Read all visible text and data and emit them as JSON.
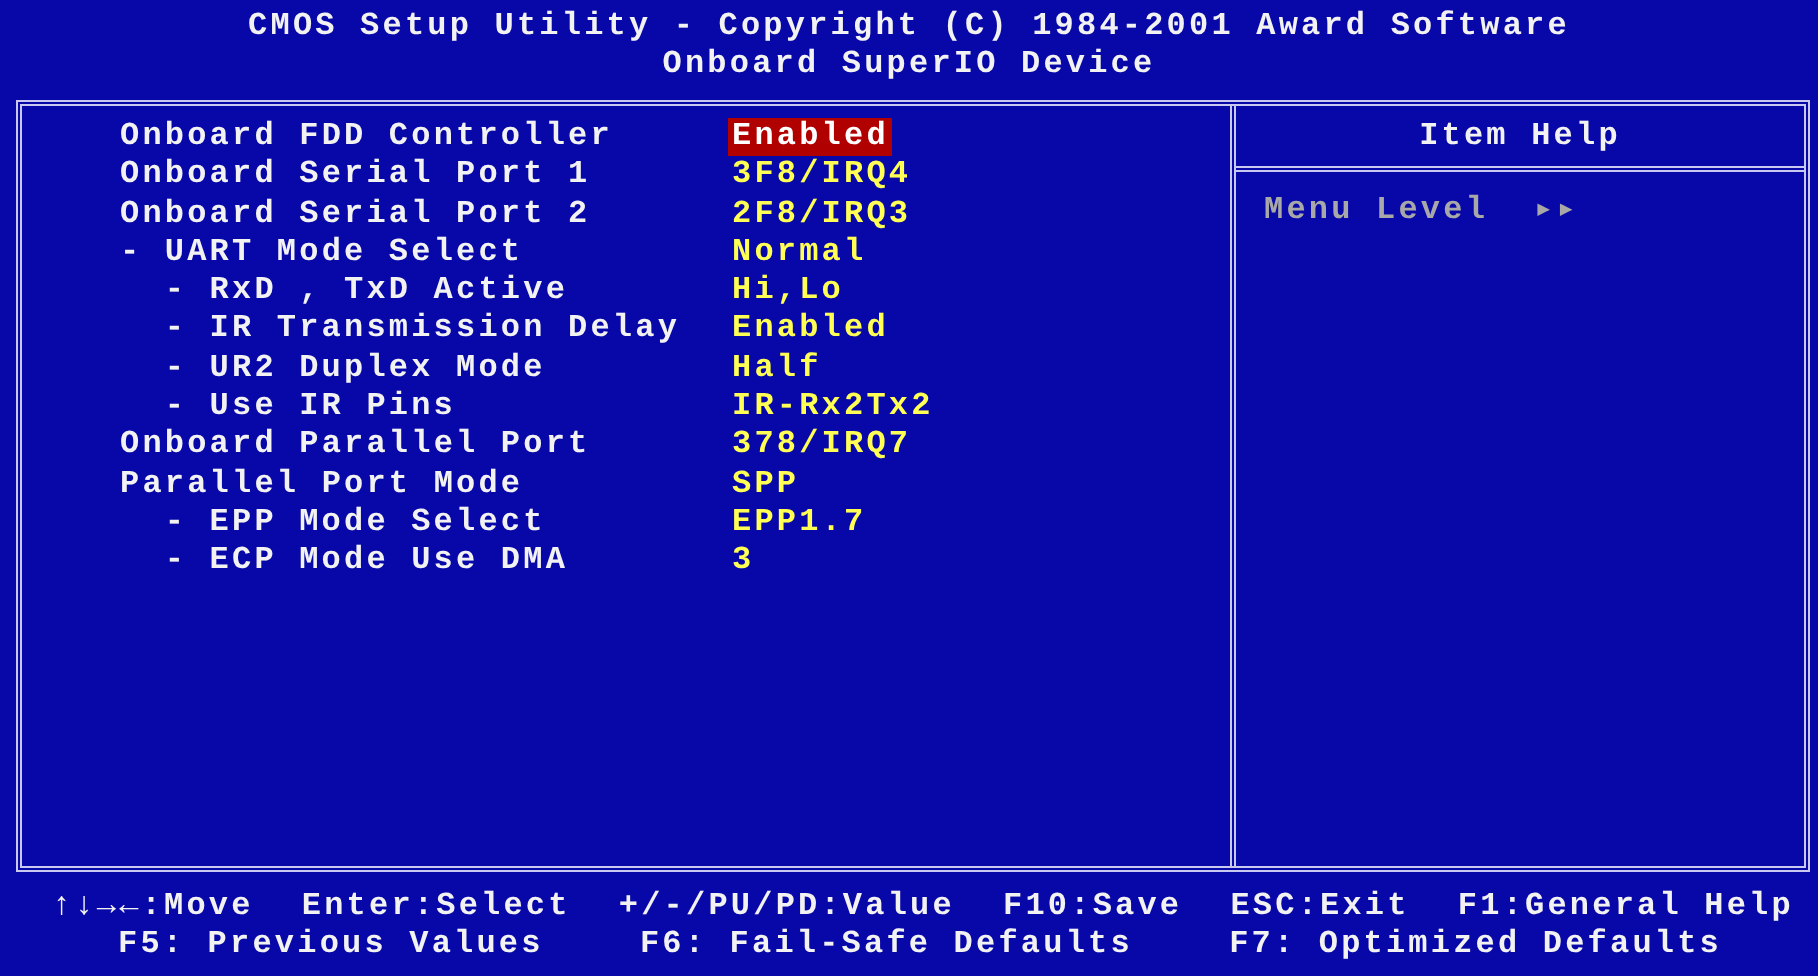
{
  "header": {
    "title": "CMOS Setup Utility - Copyright (C) 1984-2001 Award Software",
    "subtitle": "Onboard SuperIO Device"
  },
  "settings": [
    {
      "label": "Onboard FDD Controller",
      "value": "Enabled",
      "selected": true
    },
    {
      "label": "Onboard Serial Port 1",
      "value": "3F8/IRQ4",
      "selected": false
    },
    {
      "label": "Onboard Serial Port 2",
      "value": "2F8/IRQ3",
      "selected": false
    },
    {
      "label": "- UART Mode Select",
      "value": "Normal",
      "selected": false,
      "children": [
        {
          "label": "- RxD , TxD Active",
          "value": "Hi,Lo",
          "selected": false
        },
        {
          "label": "- IR Transmission Delay",
          "value": "Enabled",
          "selected": false
        },
        {
          "label": "- UR2 Duplex Mode",
          "value": "Half",
          "selected": false
        },
        {
          "label": "- Use IR Pins",
          "value": "IR-Rx2Tx2",
          "selected": false
        }
      ]
    },
    {
      "label": "Onboard Parallel Port",
      "value": "378/IRQ7",
      "selected": false
    },
    {
      "label": "Parallel Port Mode",
      "value": "SPP",
      "selected": false,
      "children": [
        {
          "label": "- EPP Mode Select",
          "value": "EPP1.7",
          "selected": false
        },
        {
          "label": "- ECP Mode Use DMA",
          "value": "3",
          "selected": false
        }
      ]
    }
  ],
  "item_help": {
    "title": "Item Help",
    "menu_level_label": "Menu Level",
    "menu_level_value": "▸▸"
  },
  "key_help": [
    [
      "↑↓→←:Move",
      "Enter:Select",
      "+/-/PU/PD:Value",
      "F10:Save",
      "ESC:Exit",
      "F1:General Help"
    ],
    [
      "F5: Previous Values",
      "F6: Fail-Safe Defaults",
      "F7: Optimized Defaults"
    ]
  ]
}
